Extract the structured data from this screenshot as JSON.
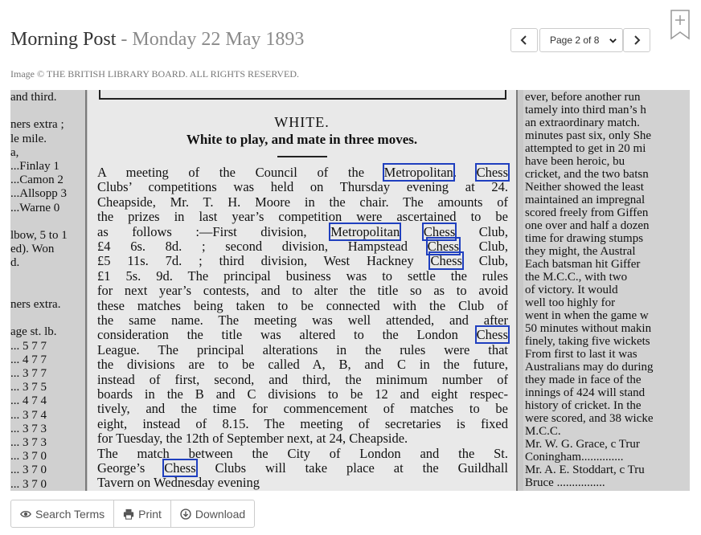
{
  "header": {
    "publication": "Morning Post",
    "separator": " - ",
    "date": "Monday 22 May 1893",
    "credit": "Image © THE BRITISH LIBRARY BOARD. ALL RIGHTS RESERVED."
  },
  "pager": {
    "prev_icon": "chevron-left-icon",
    "next_icon": "chevron-right-icon",
    "selected": "Page 2 of 8"
  },
  "bookmark_icon": "bookmark-plus-icon",
  "colors": {
    "highlight": "#1f3fbf",
    "accent_text": "#8a8a8a"
  },
  "article": {
    "left_column": [
      "and third.",
      "",
      "ners extra ;",
      "le mile.",
      "a,",
      "...Finlay 1",
      "...Camon 2",
      "...Allsopp 3",
      "...Warne 0",
      "",
      "lbow, 5 to 1",
      "ed).   Won",
      "d.",
      "",
      "",
      "ners extra.",
      "",
      "age st. lb.",
      "... 5  7  7",
      "... 4  7  7",
      "... 3  7  7",
      "... 3  7  5",
      "... 4  7  4",
      "... 3  7  4",
      "... 3  7  3",
      "... 3  7  3",
      "... 3  7  0",
      "... 3  7  0",
      "... 3  7  0"
    ],
    "center_heading": "WHITE.",
    "center_subheading": "White to play, and mate in three moves.",
    "center_lines": [
      [
        {
          "t": "A meeting of the Council of the "
        },
        {
          "t": "Metropolitan",
          "h": true
        },
        {
          "t": ". "
        },
        {
          "t": "Chess",
          "h": true
        }
      ],
      [
        {
          "t": "Clubs’ competitions was held on Thursday evening at 24."
        }
      ],
      [
        {
          "t": "Cheapside, Mr. T. H. Moore in the chair.  The amounts of"
        }
      ],
      [
        {
          "t": "the prizes in last year’s competition were ascertained to be"
        }
      ],
      [
        {
          "t": "as follows :—First division, "
        },
        {
          "t": "Metropolitan",
          "h": true
        },
        {
          "t": " "
        },
        {
          "t": "Chess",
          "h": true
        },
        {
          "t": " Club,"
        }
      ],
      [
        {
          "t": "£4  6s. 8d. ; second division, Hampstead "
        },
        {
          "t": "Chess",
          "h": true
        },
        {
          "t": " Club,"
        }
      ],
      [
        {
          "t": "£5 11s. 7d. ; third division, West Hackney "
        },
        {
          "t": "Chess",
          "h": true
        },
        {
          "t": " Club,"
        }
      ],
      [
        {
          "t": "£1 5s. 9d.   The principal business was to settle the rules"
        }
      ],
      [
        {
          "t": "for next year’s contests, and to alter the title so as to avoid"
        }
      ],
      [
        {
          "t": "these matches being taken to be connected with the Club of"
        }
      ],
      [
        {
          "t": "the same name.  The meeting was well attended, and after"
        }
      ],
      [
        {
          "t": "consideration the title was altered to the London "
        },
        {
          "t": "Chess",
          "h": true
        }
      ],
      [
        {
          "t": "League.  The principal alterations in the rules were that"
        }
      ],
      [
        {
          "t": "the divisions are to be called A, B, and C in the future,"
        }
      ],
      [
        {
          "t": "instead of first, second, and third, the minimum number of"
        }
      ],
      [
        {
          "t": "boards in the B and C divisions to be 12 and eight respec-"
        }
      ],
      [
        {
          "t": "tively, and the time for commencement of matches to be"
        }
      ],
      [
        {
          "t": "eight, instead of 8.15.  The meeting of secretaries is fixed"
        }
      ],
      [
        {
          "t": "for Tuesday, the 12th of September next, at 24, Cheapside."
        }
      ],
      [
        {
          "t": "   The match between the City of London and the St."
        }
      ],
      [
        {
          "t": "George’s "
        },
        {
          "t": "Chess",
          "h": true
        },
        {
          "t": " Clubs will take place at the Guildhall"
        }
      ],
      [
        {
          "t": "Tavern on Wednesday evening"
        }
      ]
    ],
    "right_column": [
      "ever, before another run",
      "tamely into third man’s h",
      "an extraordinary match.",
      "minutes past six, only She",
      "attempted to get in 20 mi",
      "have   been   heroic,   bu",
      "cricket, and the two batsn",
      "Neither showed the least",
      "maintained an impregnal",
      "scored freely from Giffen",
      "one over and half a dozen",
      "time for drawing stumps",
      "they might, the Austral",
      "Each batsman hit Giffer",
      "the M.C.C., with two",
      "of victory.  It  would",
      "well  too  highly  for",
      "went in when the game w",
      "50 minutes without makin",
      "finely, taking five wickets",
      "   From first to last it was",
      "Australians may do during",
      "they made in face of the",
      "innings of 424 will stand",
      "history of cricket.  In the",
      "were scored, and 38 wicke",
      "            M.C.C.",
      "Mr. W. G. Grace, c Trur",
      "   Coningham..............",
      "Mr. A. E. Stoddart, c Tru",
      "   Bruce ................"
    ]
  },
  "toolbar": {
    "search_label": "Search Terms",
    "search_icon": "eye-icon",
    "print_label": "Print",
    "print_icon": "printer-icon",
    "download_label": "Download",
    "download_icon": "download-icon"
  }
}
